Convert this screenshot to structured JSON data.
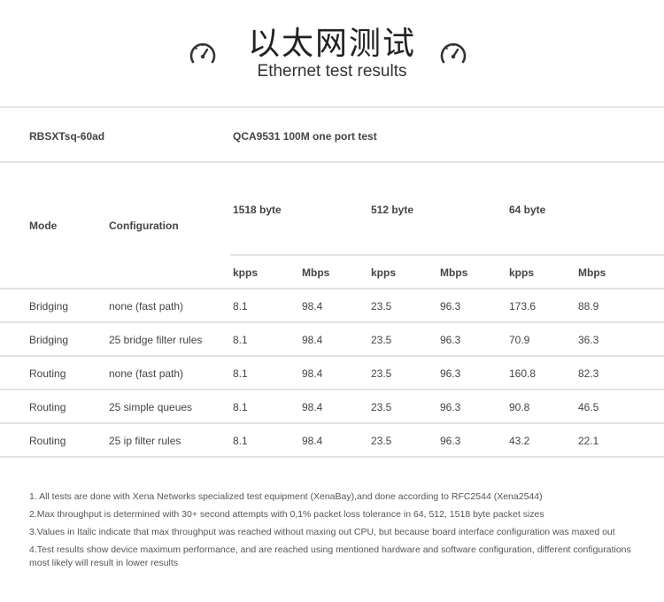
{
  "header": {
    "title_cn": "以太网测试",
    "title_en": "Ethernet test results"
  },
  "table": {
    "model": "RBSXTsq-60ad",
    "test_name": "QCA9531 100M one port test",
    "col_mode": "Mode",
    "col_configuration": "Configuration",
    "packet_sizes": [
      "1518 byte",
      "512 byte",
      "64 byte"
    ],
    "units": [
      "kpps",
      "Mbps",
      "kpps",
      "Mbps",
      "kpps",
      "Mbps"
    ],
    "rows": [
      {
        "mode": "Bridging",
        "config": "none (fast path)",
        "values": [
          "8.1",
          "98.4",
          "23.5",
          "96.3",
          "173.6",
          "88.9"
        ]
      },
      {
        "mode": "Bridging",
        "config": "25 bridge filter rules",
        "values": [
          "8.1",
          "98.4",
          "23.5",
          "96.3",
          "70.9",
          "36.3"
        ]
      },
      {
        "mode": "Routing",
        "config": "none (fast path)",
        "values": [
          "8.1",
          "98.4",
          "23.5",
          "96.3",
          "160.8",
          "82.3"
        ]
      },
      {
        "mode": "Routing",
        "config": "25 simple queues",
        "values": [
          "8.1",
          "98.4",
          "23.5",
          "96.3",
          "90.8",
          "46.5"
        ]
      },
      {
        "mode": "Routing",
        "config": "25 ip filter rules",
        "values": [
          "8.1",
          "98.4",
          "23.5",
          "96.3",
          "43.2",
          "22.1"
        ]
      }
    ]
  },
  "notes": [
    "1. All tests are done with Xena Networks specialized test equipment (XenaBay),and done according to RFC2544 (Xena2544)",
    "2.Max throughput is determined with 30+ second attempts with 0,1% packet loss tolerance in 64, 512, 1518 byte packet sizes",
    "3.Values in Italic indicate that max throughput was reached without maxing out CPU, but because board interface configuration was maxed out",
    "4.Test results show  device maximum performance, and are reached using mentioned hardware and software configuration, different configurations most likely will result in lower results"
  ],
  "icons": {
    "gauge_left": "speedometer-icon",
    "gauge_right": "speedometer-icon"
  },
  "colors": {
    "divider": "#e3e3e3",
    "text": "#444444"
  }
}
